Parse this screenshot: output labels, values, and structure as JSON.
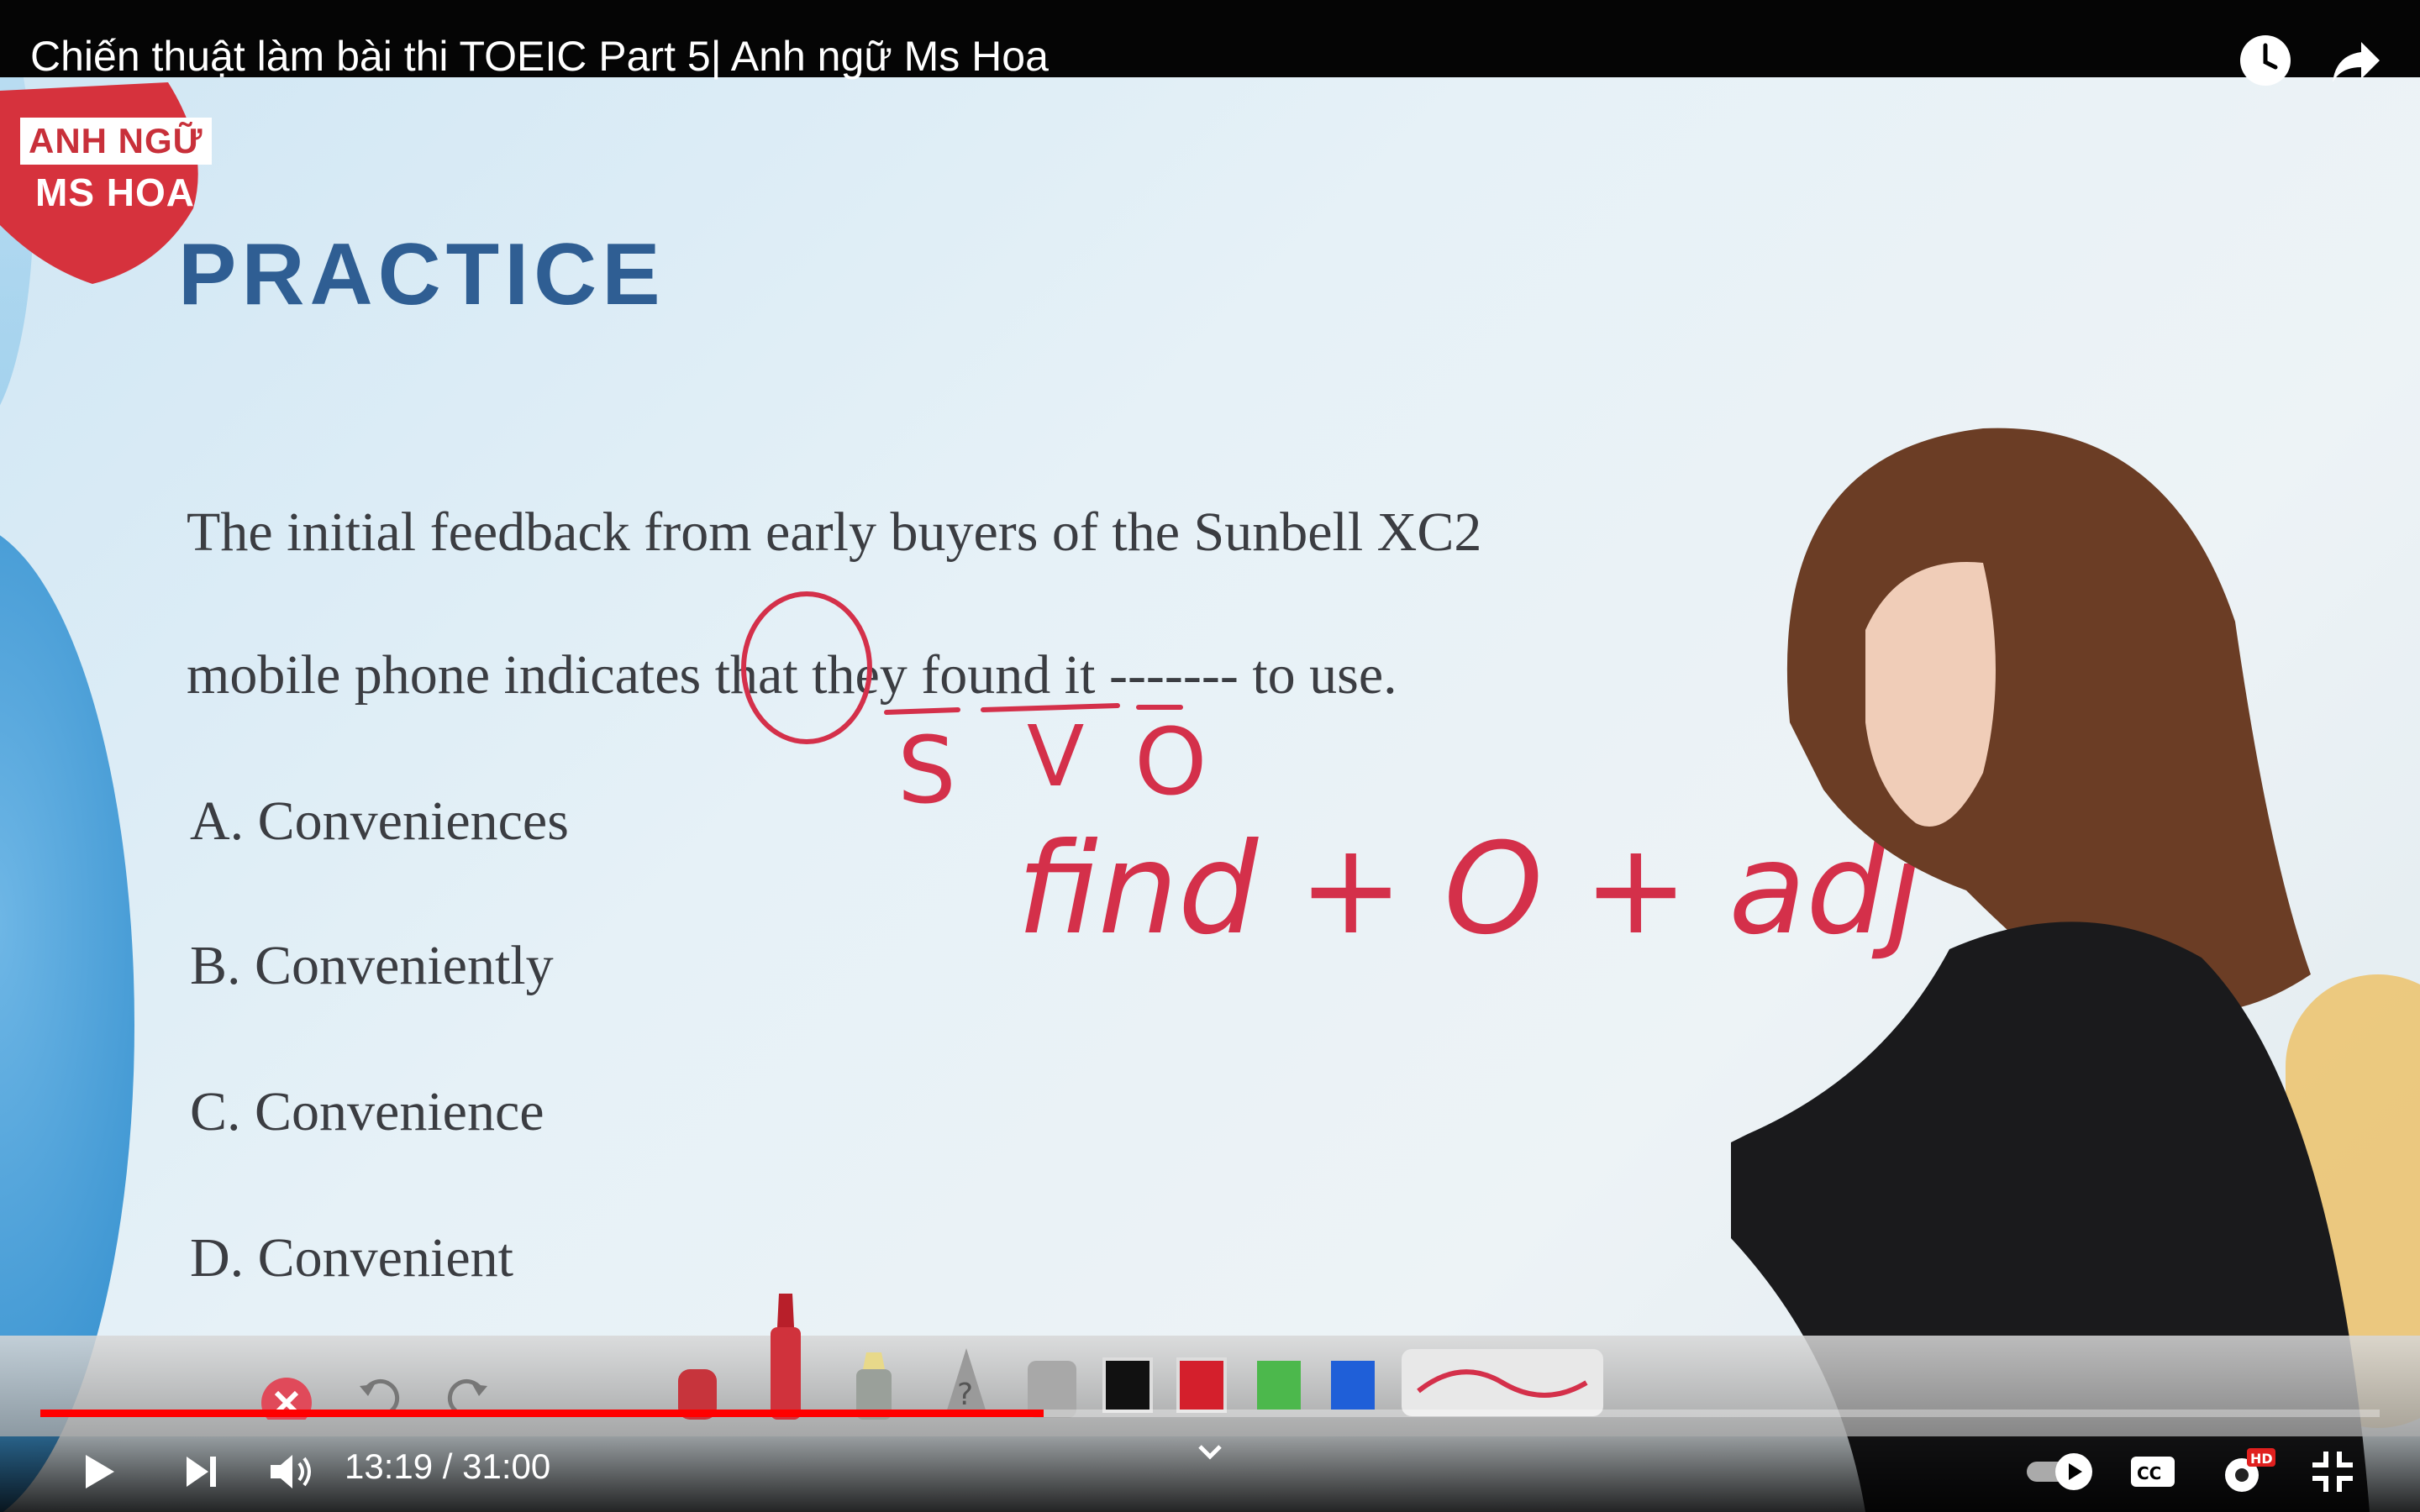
{
  "video": {
    "title": "Chiến thuật làm bài thi TOEIC Part 5| Anh ngữ Ms Hoa",
    "logo": {
      "line1": "ANH NGỮ",
      "line2": "MS HOA"
    },
    "slide": {
      "heading": "PRACTICE",
      "question_line1": "The initial feedback from early buyers of the Sunbell XC2",
      "question_line2_a": "mobile phone indicates",
      "question_line2_b": "that",
      "question_line2_c": "they",
      "question_line2_d": "found",
      "question_line2_e": "it",
      "question_line2_f": "------- to use.",
      "options": [
        "A. Conveniences",
        "B. Conveniently",
        "C. Convenience",
        "D. Convenient"
      ]
    },
    "annotations": {
      "s": "S",
      "v": "V",
      "o": "O",
      "formula": "find + O + adj",
      "ink_color": "#d4304a"
    },
    "whiteboard_colors": [
      "#111111",
      "#d41f2c",
      "#4cb84c",
      "#1f5fd8"
    ]
  },
  "player": {
    "time_current": "13:19",
    "time_total": "31:00",
    "time_display": "13:19 / 31:00",
    "progress": 0.429,
    "accent": "#ff0000",
    "hd_badge": "HD",
    "icons": [
      "play-icon",
      "next-icon",
      "volume-icon",
      "chevron-down-icon",
      "autoplay-toggle",
      "captions-icon",
      "settings-icon",
      "exit-fullscreen-icon",
      "watch-later-icon",
      "share-icon"
    ]
  }
}
